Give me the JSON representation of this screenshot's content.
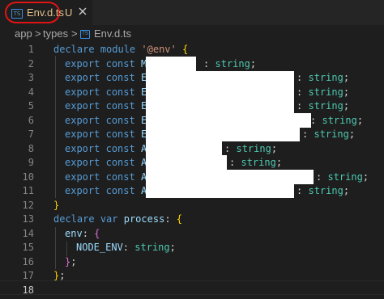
{
  "tab": {
    "filename": "Env.d.ts",
    "status": "U",
    "icon_label": "TS",
    "close_glyph": "✕"
  },
  "breadcrumb": {
    "items": [
      "app",
      "types",
      "Env.d.ts"
    ],
    "separator": ">",
    "icon_label": "TS"
  },
  "editor": {
    "line_numbers": [
      "1",
      "2",
      "3",
      "4",
      "5",
      "6",
      "7",
      "8",
      "9",
      "10",
      "11",
      "12",
      "13",
      "14",
      "15",
      "16",
      "17",
      "18"
    ],
    "active_line": "18",
    "code": {
      "l1": {
        "kw1": "declare",
        "kw2": "module",
        "str": "'@env'",
        "brace": "{"
      },
      "l2": {
        "kw1": "export",
        "kw2": "const",
        "visible_name": "M",
        "suffix_colon": ":",
        "type": "string",
        "semi": ";"
      },
      "l3": {
        "kw1": "export",
        "kw2": "const",
        "visible_name": "E",
        "suffix_colon": ":",
        "type": "string",
        "semi": ";"
      },
      "l4": {
        "kw1": "export",
        "kw2": "const",
        "visible_name": "E",
        "suffix_colon": ":",
        "type": "string",
        "semi": ";"
      },
      "l5": {
        "kw1": "export",
        "kw2": "const",
        "visible_name": "E",
        "suffix_colon": ":",
        "type": "string",
        "semi": ";"
      },
      "l6": {
        "kw1": "export",
        "kw2": "const",
        "visible_name": "E",
        "suffix_colon": ":",
        "type": "string",
        "semi": ";"
      },
      "l7": {
        "kw1": "export",
        "kw2": "const",
        "visible_name": "E",
        "suffix_colon": ":",
        "type": "string",
        "semi": ";"
      },
      "l8": {
        "kw1": "export",
        "kw2": "const",
        "visible_name": "A",
        "suffix_colon": ":",
        "type": "string",
        "semi": ";"
      },
      "l9": {
        "kw1": "export",
        "kw2": "const",
        "visible_name": "A",
        "suffix_colon": ":",
        "type": "string",
        "semi": ";"
      },
      "l10": {
        "kw1": "export",
        "kw2": "const",
        "visible_name": "A",
        "suffix_colon": ":",
        "type": "string",
        "semi": ";"
      },
      "l11": {
        "kw1": "export",
        "kw2": "const",
        "visible_name": "A",
        "suffix_colon": ":",
        "type": "string",
        "semi": ";"
      },
      "l12": {
        "brace": "}"
      },
      "l13": {
        "kw1": "declare",
        "kw2": "var",
        "name": "process",
        "colon": ":",
        "brace": "{"
      },
      "l14": {
        "name": "env",
        "colon": ":",
        "brace": "{"
      },
      "l15": {
        "name": "NODE_ENV",
        "colon": ":",
        "type": "string",
        "semi": ";"
      },
      "l16": {
        "brace": "}",
        "semi": ";"
      },
      "l17": {
        "brace": "}",
        "semi": ";"
      }
    }
  },
  "colors": {
    "background": "#1e1e1e",
    "tab_bar": "#252526",
    "keyword": "#569cd6",
    "string": "#ce9178",
    "type": "#4ec9b0",
    "variable": "#9cdcfe",
    "bracket_level1": "#ffd700",
    "bracket_level2": "#da70d6",
    "bracket_level3": "#179fff",
    "highlight_circle": "#e01414",
    "modified_file": "#e2c08d",
    "redaction": "#ffffff"
  }
}
